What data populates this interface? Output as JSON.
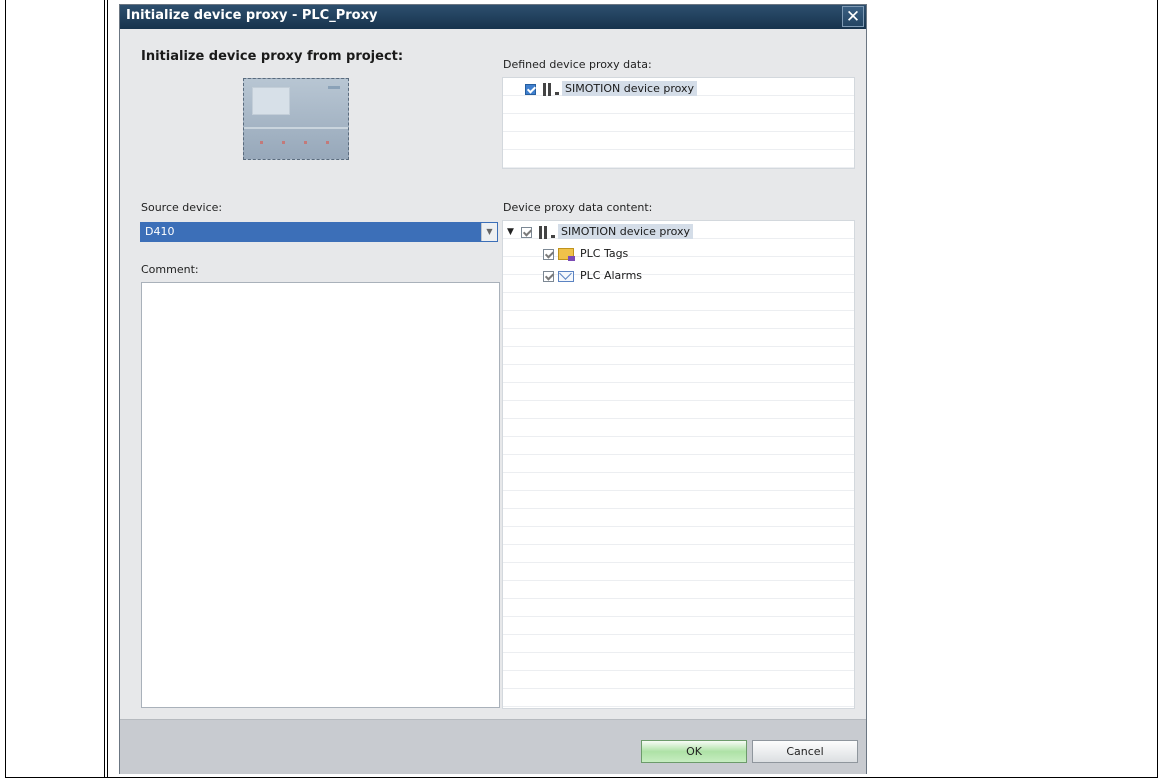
{
  "dialog": {
    "title": "Initialize device proxy - PLC_Proxy",
    "close_glyph": "✕"
  },
  "left": {
    "heading": "Initialize device proxy from project:",
    "source_label": "Source device:",
    "source_value": "D410",
    "comment_label": "Comment:",
    "comment_value": ""
  },
  "defined": {
    "label": "Defined device proxy data:",
    "items": [
      {
        "label": "SIMOTION device proxy",
        "checked": true,
        "icon": "device-proxy-icon"
      }
    ]
  },
  "content": {
    "label": "Device proxy data content:",
    "root": {
      "label": "SIMOTION device proxy",
      "expanded": true,
      "icon": "device-proxy-icon"
    },
    "children": [
      {
        "label": "PLC Tags",
        "icon": "plc-tags-folder-icon"
      },
      {
        "label": "PLC Alarms",
        "icon": "plc-alarms-icon"
      }
    ]
  },
  "buttons": {
    "ok": "OK",
    "cancel": "Cancel"
  },
  "colors": {
    "title_bar": "#1f3f5c",
    "selected_input": "#3c6fb8",
    "ok_button": "#aee2a6"
  }
}
